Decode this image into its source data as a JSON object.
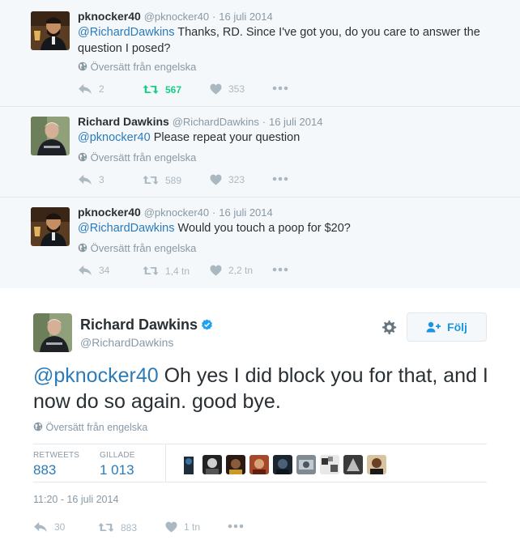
{
  "tweets": [
    {
      "name": "pknocker40",
      "handle": "@pknocker40",
      "date": "16 juli 2014",
      "mention": "@RichardDawkins",
      "text": "Thanks, RD. Since I've got you, do you care to answer the question I posed?",
      "translate": "Översätt från engelska",
      "replies": "2",
      "retweets": "567",
      "likes": "353"
    },
    {
      "name": "Richard Dawkins",
      "handle": "@RichardDawkins",
      "date": "16 juli 2014",
      "mention": "@pknocker40",
      "text": "Please repeat your question",
      "translate": "Översätt från engelska",
      "replies": "3",
      "retweets": "589",
      "likes": "323"
    },
    {
      "name": "pknocker40",
      "handle": "@pknocker40",
      "date": "16 juli 2014",
      "mention": "@RichardDawkins",
      "text": "Would you touch a poop for $20?",
      "translate": "Översätt från engelska",
      "replies": "34",
      "retweets": "1,4 tn",
      "likes": "2,2 tn"
    }
  ],
  "main": {
    "name": "Richard Dawkins",
    "handle": "@RichardDawkins",
    "follow": "Följ",
    "mention": "@pknocker40",
    "text": "Oh yes I did block you for that, and I now do so again. good bye.",
    "translate": "Översätt från engelska",
    "stats": {
      "retweets_label": "RETWEETS",
      "retweets_value": "883",
      "likes_label": "GILLADE",
      "likes_value": "1 013"
    },
    "timestamp": "11:20 - 16 juli 2014",
    "actions": {
      "replies": "30",
      "retweets": "883",
      "likes": "1 tn"
    }
  },
  "colors": {
    "link": "#2b7bb9",
    "retweet_active": "#19cf86",
    "muted": "#8899a6",
    "verified": "#1da1f2"
  },
  "icons": [
    "reply-icon",
    "retweet-icon",
    "heart-icon",
    "more-icon",
    "globe-icon",
    "gear-icon",
    "verified-badge-icon",
    "follow-user-icon"
  ]
}
